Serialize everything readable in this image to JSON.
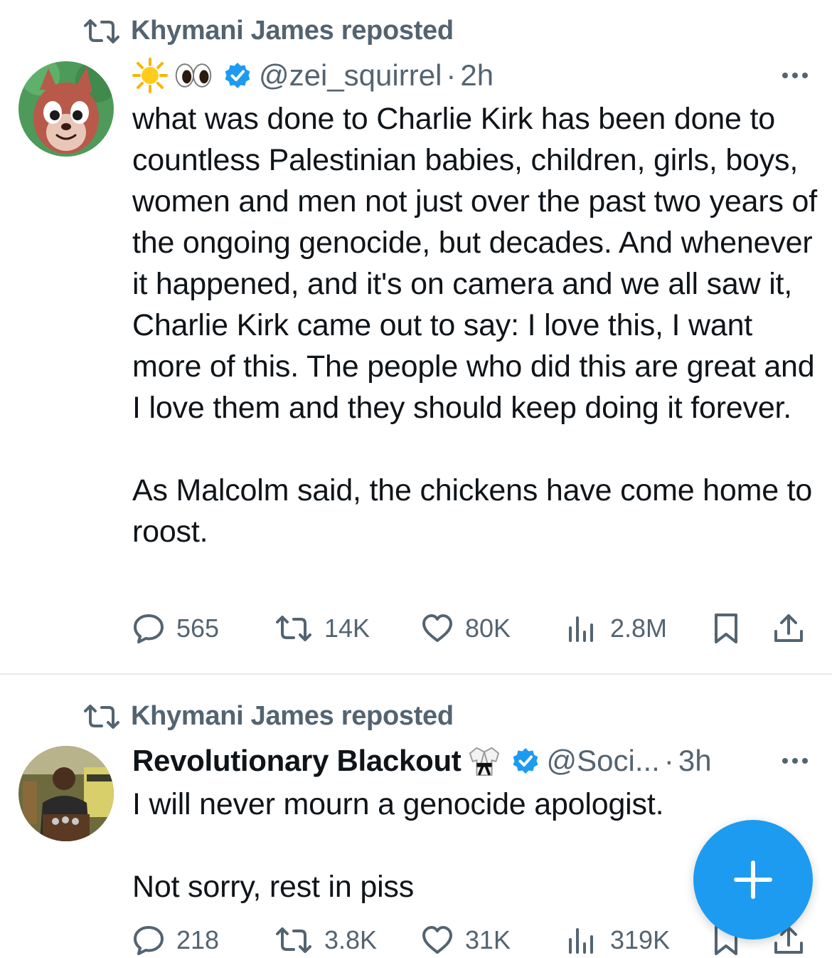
{
  "posts": [
    {
      "repost_label": "Khymani James reposted",
      "display_name": "",
      "name_emojis": [
        "sun-emoji",
        "eyes-emoji"
      ],
      "verified": true,
      "handle": "@zei_squirrel",
      "time": "2h",
      "paragraphs": [
        "what was done to Charlie Kirk has been done to countless Palestinian babies, children, girls, boys, women and men not just over the past two years of the ongoing genocide, but decades. And whenever it happened, and it's on camera and we all saw it, Charlie Kirk came out to say: I love this, I want more of this. The people who did this are great and I love them and they should keep doing it forever.",
        "As Malcolm said, the chickens have come home to roost."
      ],
      "stats": {
        "replies": "565",
        "reposts": "14K",
        "likes": "80K",
        "views": "2.8M"
      }
    },
    {
      "repost_label": "Khymani James reposted",
      "display_name": "Revolutionary Blackout",
      "name_emojis": [
        "martial-arts-uniform-emoji"
      ],
      "verified": true,
      "handle": "@Soci...",
      "time": "3h",
      "paragraphs": [
        "I will never mourn a genocide apologist.",
        "Not sorry, rest in piss"
      ],
      "stats": {
        "replies": "218",
        "reposts": "3.8K",
        "likes": "31K",
        "views": "319K"
      }
    }
  ],
  "separator_dot": "·",
  "colors": {
    "accent": "#1d9bf0",
    "secondary_text": "#536471",
    "primary_text": "#0f1419",
    "divider": "#e7e9ea"
  },
  "fab": {
    "icon": "plus-icon"
  }
}
